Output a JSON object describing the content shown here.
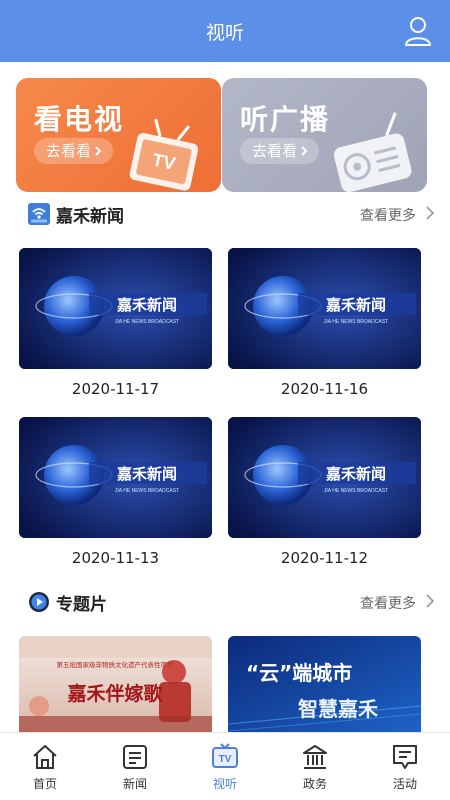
{
  "header": {
    "title": "视听"
  },
  "promos": [
    {
      "title": "看电视",
      "cta": "去看看"
    },
    {
      "title": "听广播",
      "cta": "去看看"
    }
  ],
  "news_section": {
    "title": "嘉禾新闻",
    "more": "查看更多",
    "items": [
      {
        "banner": "嘉禾新闻",
        "subtitle": "JIA HE NEWS BROADCAST",
        "date": "2020-11-17"
      },
      {
        "banner": "嘉禾新闻",
        "subtitle": "JIA HE NEWS BROADCAST",
        "date": "2020-11-16"
      },
      {
        "banner": "嘉禾新闻",
        "subtitle": "JIA HE NEWS BROADCAST",
        "date": "2020-11-13"
      },
      {
        "banner": "嘉禾新闻",
        "subtitle": "JIA HE NEWS BROADCAST",
        "date": "2020-11-12"
      }
    ]
  },
  "feature_section": {
    "title": "专题片",
    "more": "查看更多",
    "items": [
      {
        "caption": "第五批国家级非物质文化遗产代表性项目",
        "title": "嘉禾伴嫁歌"
      },
      {
        "title_line1": "“云”端城市",
        "title_line2": "智慧嘉禾"
      }
    ]
  },
  "tabbar": [
    {
      "label": "首页",
      "icon": "home-icon"
    },
    {
      "label": "新闻",
      "icon": "news-icon"
    },
    {
      "label": "视听",
      "icon": "tv-icon",
      "active": true
    },
    {
      "label": "政务",
      "icon": "government-icon"
    },
    {
      "label": "活动",
      "icon": "activity-icon"
    }
  ],
  "colors": {
    "header": "#5b8fe8",
    "active_tab": "#4a7fe0",
    "tv_promo": "#f07a3e",
    "radio_promo": "#a9aec0"
  }
}
